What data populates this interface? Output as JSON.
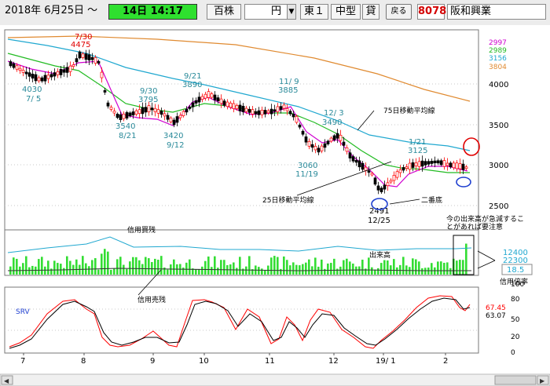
{
  "toolbar": {
    "date": "2018年 6月25日 ～",
    "time": "14日 14:17",
    "unit": "百株",
    "currency": "円",
    "market": "東１",
    "size": "中型",
    "loan": "貸",
    "back_label": "戻る",
    "code": "8078",
    "company": "阪和興業"
  },
  "legend": {
    "values": [
      {
        "text": "2997",
        "color": "#d000d0"
      },
      {
        "text": "2989",
        "color": "#22bb22"
      },
      {
        "text": "3156",
        "color": "#20a8d0"
      },
      {
        "text": "3804",
        "color": "#e08a30"
      }
    ]
  },
  "price_axis": [
    "4000",
    "3500",
    "3000",
    "2500"
  ],
  "annotations": {
    "mid_730": "7/30",
    "val_4475": "4475",
    "val_4030": "4030",
    "mid_75": "7/ 5",
    "val_3540": "3540",
    "mid_821": "8/21",
    "mid_930": "9/30",
    "val_3795": "3795",
    "mid_921": "9/21",
    "val_3890": "3890",
    "val_3420": "3420",
    "mid_912": "9/12",
    "mid_119": "11/ 9",
    "val_3885": "3885",
    "mid_123": "12/ 3",
    "val_3490": "3490",
    "val_3060": "3060",
    "mid_1119": "11/19",
    "mid_121": "1/21",
    "val_3125": "3125",
    "val_2491": "2491",
    "mid_1225": "12/25",
    "ma75_label": "75日移動平均線",
    "ma25_label": "25日移動平均線",
    "second_bottom": "二番底",
    "warn_line1": "今の出来高が急減するこ",
    "warn_line2": "とがあれば要注意"
  },
  "volume_panel": {
    "margin_buy_label": "信用買残",
    "margin_sell_label": "信用売残",
    "volume_label": "出来高",
    "val_12400": "12400",
    "val_22300": "22300",
    "ratio_value": "18.5",
    "ratio_label": "信用倍率"
  },
  "srv_panel": {
    "label": "SRV",
    "val1": "67.45",
    "val2": "63.07",
    "axis": [
      "100",
      "80",
      "50",
      "20",
      "0"
    ]
  },
  "x_axis": [
    "7",
    "8",
    "9",
    "10",
    "11",
    "12",
    "19/ 1",
    "2"
  ],
  "colors": {
    "up_candle": "#ff0000",
    "down_candle": "#000000",
    "ma_short": "#d000d0",
    "ma_25": "#22bb22",
    "ma_75": "#20a8d0",
    "ma_long": "#e08a30",
    "volume": "#33dd33",
    "annotation": "#2a8a9a",
    "callout_red": "#e00000",
    "callout_blue": "#2040d0"
  }
}
